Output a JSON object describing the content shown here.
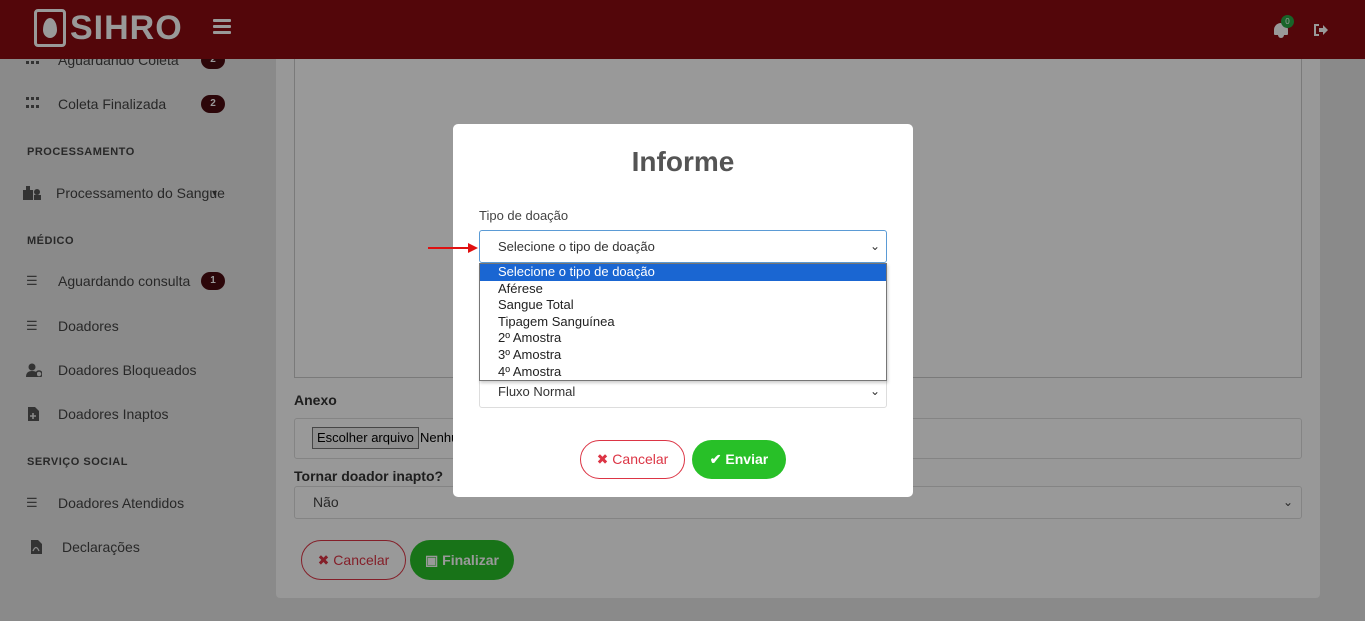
{
  "app": {
    "logo_text": "SIHRO"
  },
  "header": {
    "notification_count": "0"
  },
  "sidebar": {
    "items": [
      {
        "label": "Aguardando Coleta",
        "badge": "2"
      },
      {
        "label": "Coleta Finalizada",
        "badge": "2"
      },
      {
        "label": "Processamento do Sangue"
      },
      {
        "label": "Aguardando consulta",
        "badge": "1"
      },
      {
        "label": "Doadores"
      },
      {
        "label": "Doadores Bloqueados"
      },
      {
        "label": "Doadores Inaptos"
      },
      {
        "label": "Doadores Atendidos"
      },
      {
        "label": "Declarações"
      }
    ],
    "sections": {
      "processamento": "PROCESSAMENTO",
      "medico": "MÉDICO",
      "servico_social": "SERVIÇO SOCIAL"
    }
  },
  "main": {
    "anexo_label": "Anexo",
    "file_button": "Escolher arquivo",
    "file_status": "Nenhu",
    "inapto_label": "Tornar doador inapto?",
    "inapto_value": "Não",
    "cancel_label": "Cancelar",
    "finalizar_label": "Finalizar"
  },
  "modal": {
    "title": "Informe",
    "tipo_label": "Tipo de doação",
    "tipo_selected": "Selecione o tipo de doação",
    "options": [
      "Selecione o tipo de doação",
      "Aférese",
      "Sangue Total",
      "Tipagem Sanguínea",
      "2º Amostra",
      "3º Amostra",
      "4º Amostra"
    ],
    "fluxo_value": "Fluxo Normal",
    "cancel_label": "Cancelar",
    "enviar_label": "Enviar"
  },
  "colors": {
    "header": "#8b0a12",
    "accent_green": "#28c028",
    "danger": "#dc3545",
    "option_selected": "#1a66d2"
  }
}
